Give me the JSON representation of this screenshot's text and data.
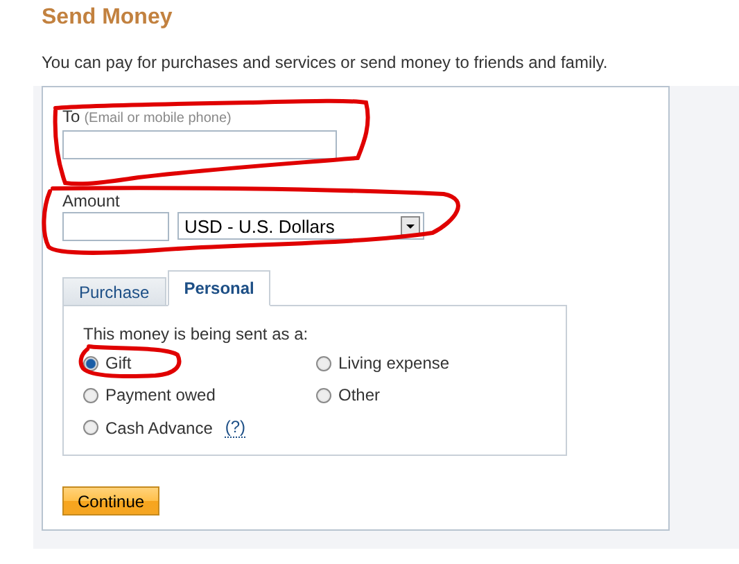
{
  "title": "Send Money",
  "intro": "You can pay for purchases and services or send money to friends and family.",
  "to_field": {
    "label": "To",
    "hint": "(Email or mobile phone)"
  },
  "amount_field": {
    "label": "Amount"
  },
  "currency_select": {
    "value": "USD - U.S. Dollars"
  },
  "tabs": [
    {
      "label": "Purchase",
      "selected": false
    },
    {
      "label": "Personal",
      "selected": true
    }
  ],
  "purpose": {
    "prompt": "This money is being sent as a:",
    "options": [
      {
        "label": "Gift",
        "selected": true
      },
      {
        "label": "Living expense",
        "selected": false
      },
      {
        "label": "Payment owed",
        "selected": false
      },
      {
        "label": "Other",
        "selected": false
      },
      {
        "label": "Cash Advance",
        "selected": false,
        "help": "(?)"
      }
    ]
  },
  "buttons": [
    "Continue"
  ]
}
